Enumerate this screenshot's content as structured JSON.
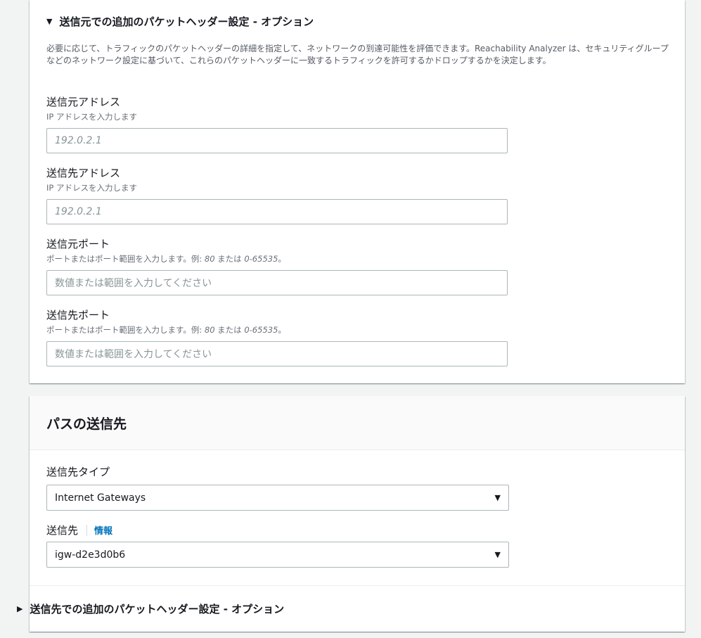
{
  "source_section": {
    "expander_label": "送信元での追加のパケットヘッダー設定 - オプション",
    "expander_caret": "▼",
    "description": "必要に応じて、トラフィックのパケットヘッダーの詳細を指定して、ネットワークの到達可能性を評価できます。Reachability Analyzer は、セキュリティグループなどのネットワーク設定に基づいて、これらのパケットヘッダーに一致するトラフィックを許可するかドロップするかを決定します。",
    "fields": {
      "source_address": {
        "label": "送信元アドレス",
        "hint": "IP アドレスを入力します",
        "placeholder": "192.0.2.1"
      },
      "dest_address": {
        "label": "送信先アドレス",
        "hint": "IP アドレスを入力します",
        "placeholder": "192.0.2.1"
      },
      "source_port": {
        "label": "送信元ポート",
        "hint_prefix": "ポートまたはポート範囲を入力します。例: ",
        "hint_example_1": "80",
        "hint_mid": " または ",
        "hint_example_2": "0-65535",
        "hint_suffix": "。",
        "placeholder": "数値または範囲を入力してください"
      },
      "dest_port": {
        "label": "送信先ポート",
        "hint_prefix": "ポートまたはポート範囲を入力します。例: ",
        "hint_example_1": "80",
        "hint_mid": " または ",
        "hint_example_2": "0-65535",
        "hint_suffix": "。",
        "placeholder": "数値または範囲を入力してください"
      }
    }
  },
  "destination_panel": {
    "title": "パスの送信先",
    "dest_type": {
      "label": "送信先タイプ",
      "value": "Internet Gateways"
    },
    "destination": {
      "label": "送信先",
      "info_link": "情報",
      "value": "igw-d2e3d0b6"
    },
    "select_arrow": "▼",
    "expander_label": "送信先での追加のパケットヘッダー設定 - オプション",
    "expander_caret": "▶"
  },
  "colors": {
    "background": "#f2f3f3",
    "panel": "#ffffff",
    "link": "#0073bb",
    "text": "#16191f",
    "hint": "#687078",
    "border": "#aab7b8"
  }
}
